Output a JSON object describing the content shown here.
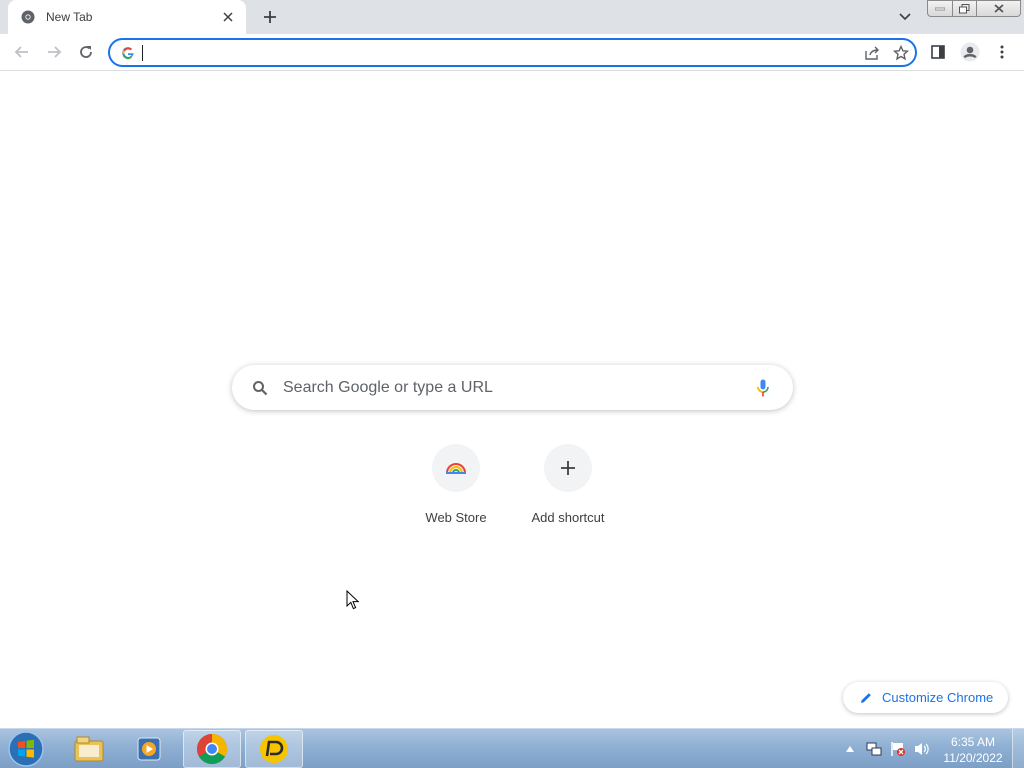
{
  "browser": {
    "tab": {
      "title": "New Tab",
      "close_icon": "close-icon",
      "favicon": "chrome-icon"
    },
    "new_tab_icon": "plus-icon",
    "tab_search_icon": "chevron-down-icon",
    "window_controls": [
      "minimize",
      "maximize",
      "close"
    ]
  },
  "toolbar": {
    "back_icon": "back-arrow-icon",
    "forward_icon": "forward-arrow-icon",
    "reload_icon": "reload-icon",
    "omnibox": {
      "value": "",
      "placeholder": "",
      "google_icon": "google-g-icon"
    },
    "share_icon": "share-icon",
    "bookmark_icon": "star-icon",
    "side_panel_icon": "side-panel-icon",
    "profile_icon": "profile-icon",
    "menu_icon": "kebab-menu-icon"
  },
  "ntp": {
    "search_placeholder": "Search Google or type a URL",
    "shortcuts": [
      {
        "label": "Web Store",
        "icon": "web-store-icon"
      },
      {
        "label": "Add shortcut",
        "icon": "plus-icon"
      }
    ],
    "customize_label": "Customize Chrome"
  },
  "taskbar": {
    "apps": [
      "windows-explorer-icon",
      "media-player-icon",
      "chrome-icon",
      "anydesk-icon"
    ],
    "clock_time": "6:35 AM",
    "clock_date": "11/20/2022"
  },
  "colors": {
    "accent": "#1a73e8",
    "tabstrip": "#dee1e6",
    "taskbar": "#8fb0d3"
  }
}
